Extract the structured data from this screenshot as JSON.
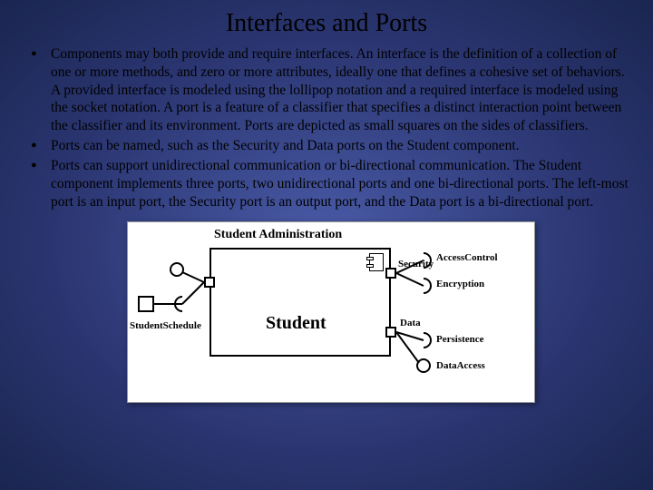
{
  "title": "Interfaces and Ports",
  "bullets": [
    "Components may both provide and require interfaces.  An interface is the definition of a collection of one or more methods, and zero or more attributes, ideally one that defines a cohesive set of behaviors.  A provided interface is modeled using the lollipop notation and a required interface is modeled using the socket notation.  A port is a feature of a classifier that specifies a distinct interaction point between the classifier and its environment.  Ports are depicted as small squares on the sides of classifiers.",
    "Ports can be named, such as the Security and Data ports on the Student component.",
    "Ports can support unidirectional communication or bi-directional communication.  The Student component implements three ports, two unidirectional ports and one bi-directional ports.  The left-most port is an input port, the Security port is an output port, and the Data port is a bi-directional port."
  ],
  "diagram": {
    "top_label": "Student Administration",
    "center_label": "Student",
    "left_label": "StudentSchedule",
    "right_port1": "Security",
    "right_port2": "Data",
    "right_if1": "AccessControl",
    "right_if2": "Encryption",
    "right_if3": "Persistence",
    "right_if4": "DataAccess"
  }
}
